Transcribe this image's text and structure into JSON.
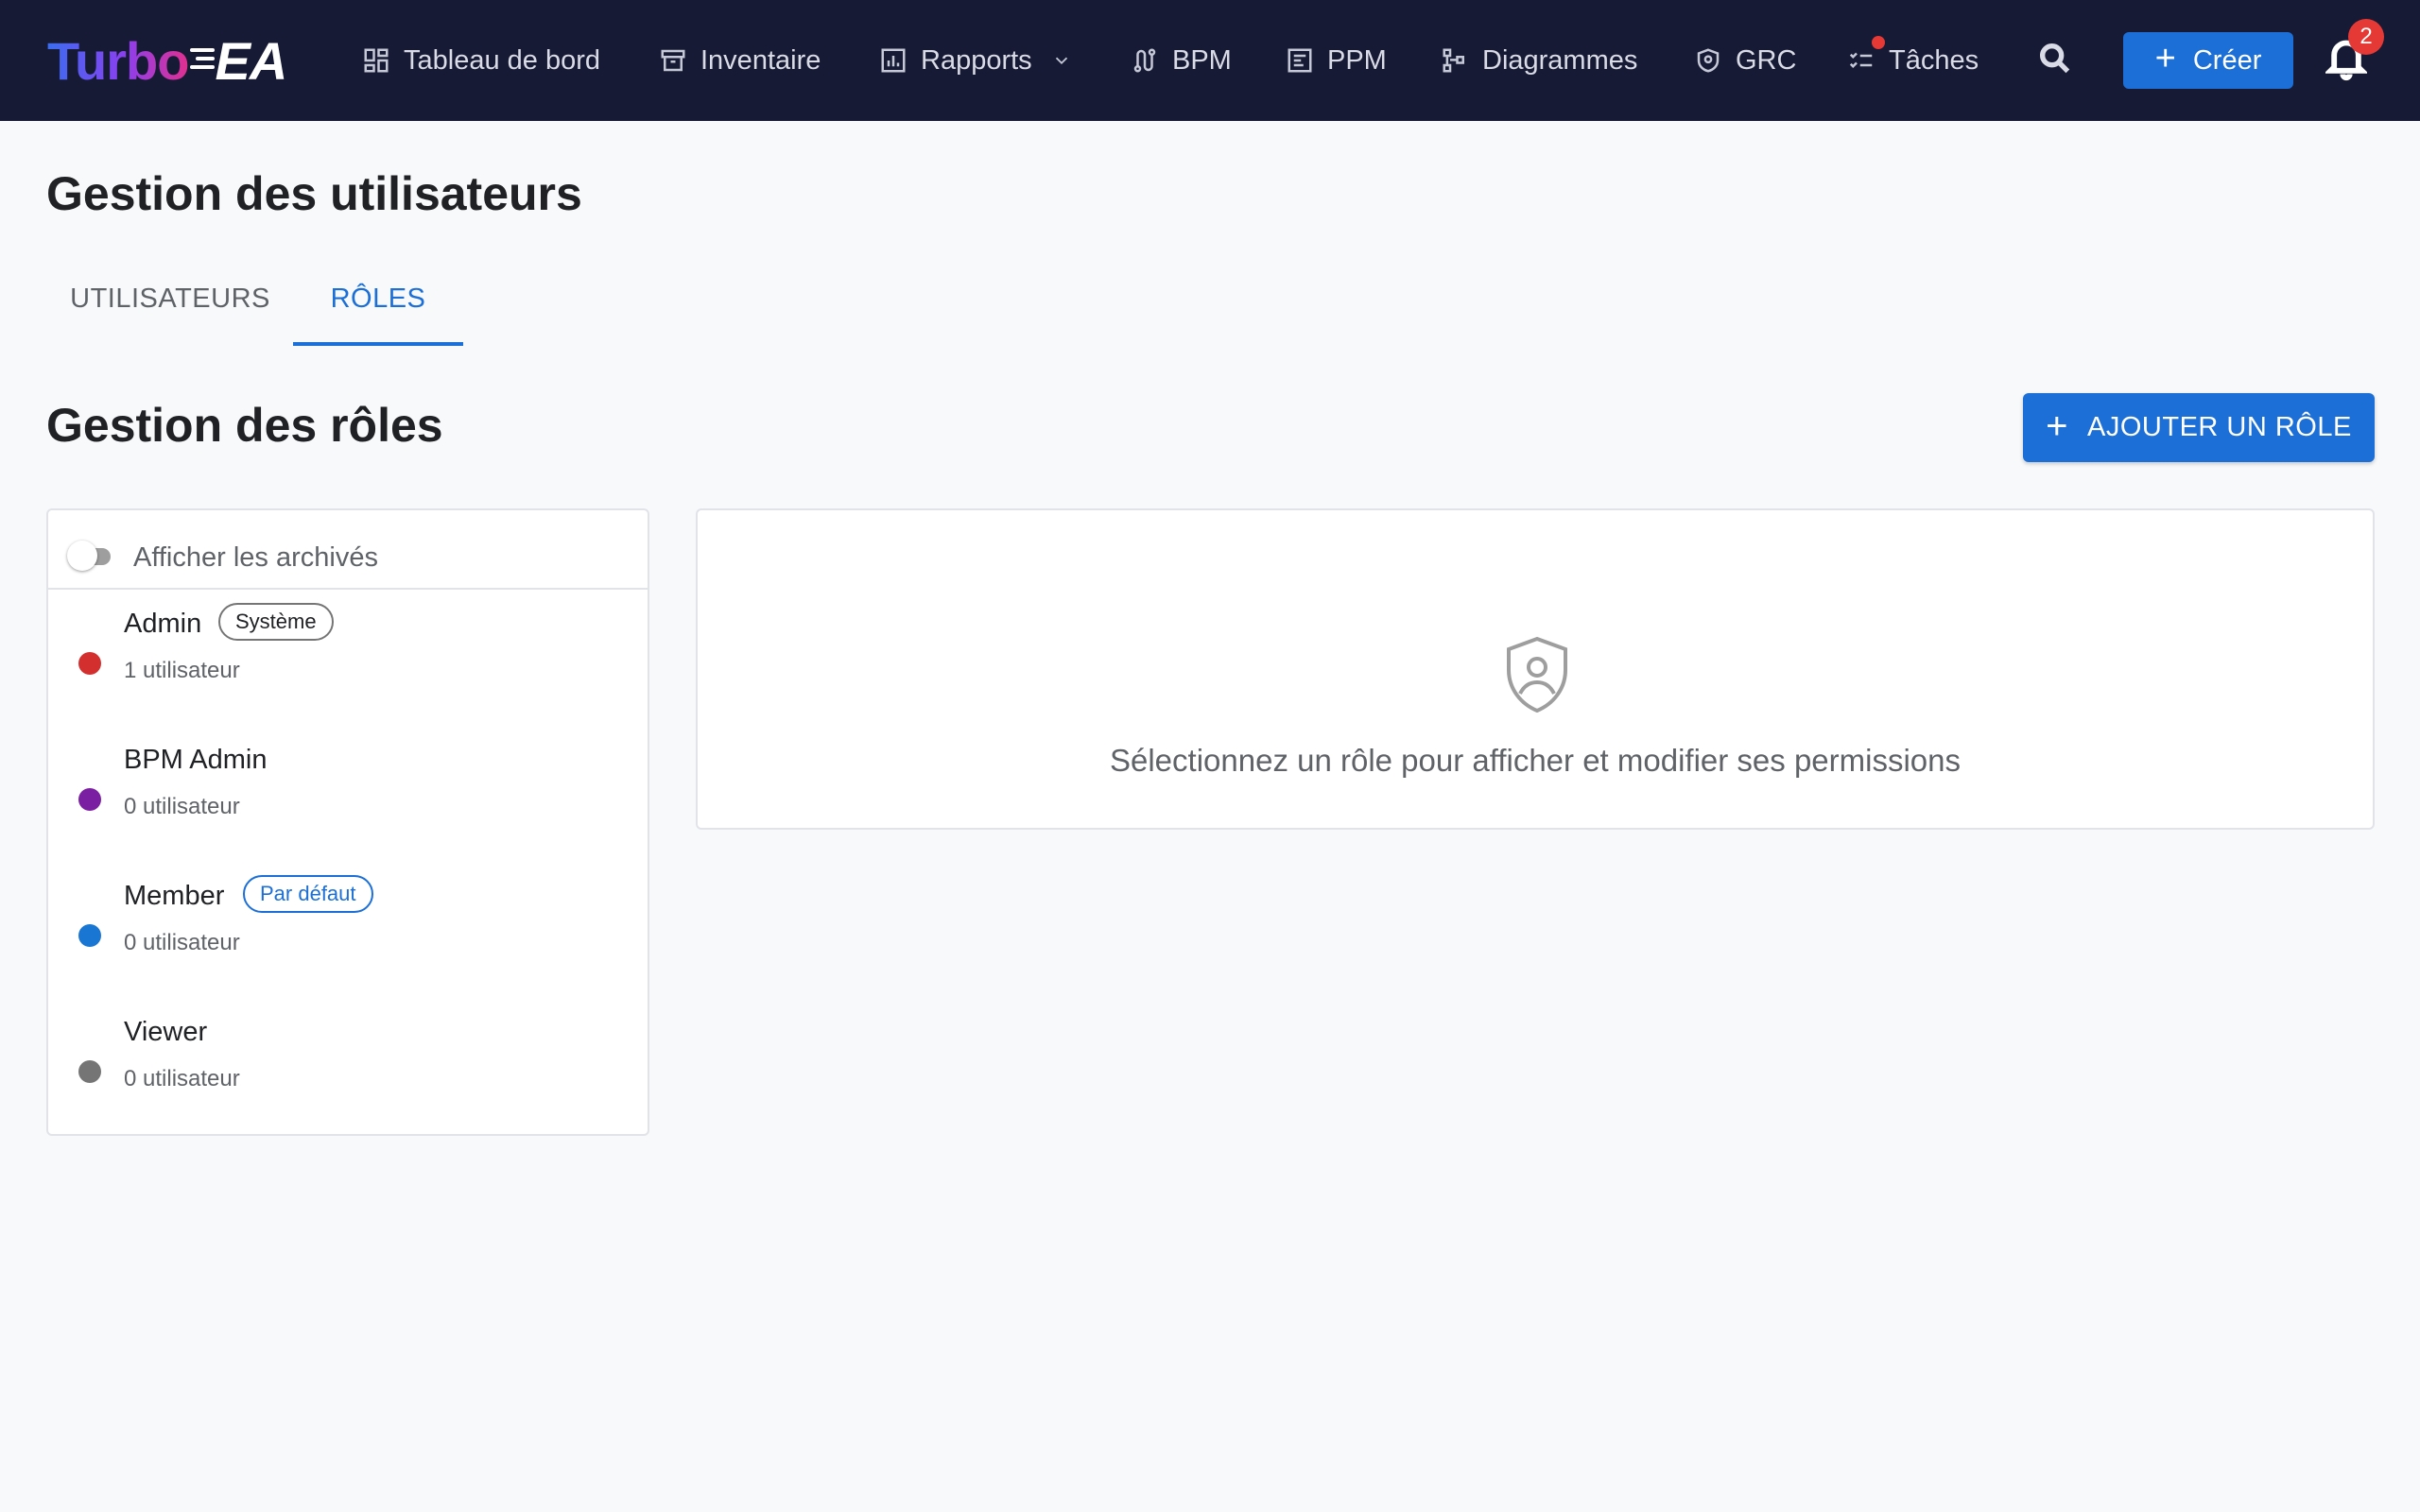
{
  "app": {
    "logo_part1": "Turbo",
    "logo_part2": "EA",
    "colors": {
      "topbar": "#171a35",
      "accent": "#1c6fd6",
      "badge": "#e53935"
    }
  },
  "nav": {
    "dashboard": "Tableau de bord",
    "inventory": "Inventaire",
    "reports": "Rapports",
    "bpm": "BPM",
    "ppm": "PPM",
    "diagrams": "Diagrammes",
    "grc": "GRC",
    "tasks": "Tâches"
  },
  "header": {
    "create_label": "Créer",
    "notification_count": "2"
  },
  "page": {
    "title": "Gestion des utilisateurs"
  },
  "tabs": {
    "users": "UTILISATEURS",
    "roles": "RÔLES",
    "active": "roles"
  },
  "roles_section": {
    "title": "Gestion des rôles",
    "add_button": "AJOUTER UN RÔLE",
    "show_archived_label": "Afficher les archivés",
    "show_archived": false
  },
  "roles": [
    {
      "name": "Admin",
      "count": "1 utilisateur",
      "color": "#d32f2f",
      "chip": "Système",
      "chip_type": "system"
    },
    {
      "name": "BPM Admin",
      "count": "0 utilisateur",
      "color": "#7b1fa2",
      "chip": "",
      "chip_type": ""
    },
    {
      "name": "Member",
      "count": "0 utilisateur",
      "color": "#1976d2",
      "chip": "Par défaut",
      "chip_type": "default"
    },
    {
      "name": "Viewer",
      "count": "0 utilisateur",
      "color": "#757575",
      "chip": "",
      "chip_type": ""
    }
  ],
  "detail": {
    "icon": "shield-person-icon",
    "empty_message": "Sélectionnez un rôle pour afficher et modifier ses permissions"
  }
}
